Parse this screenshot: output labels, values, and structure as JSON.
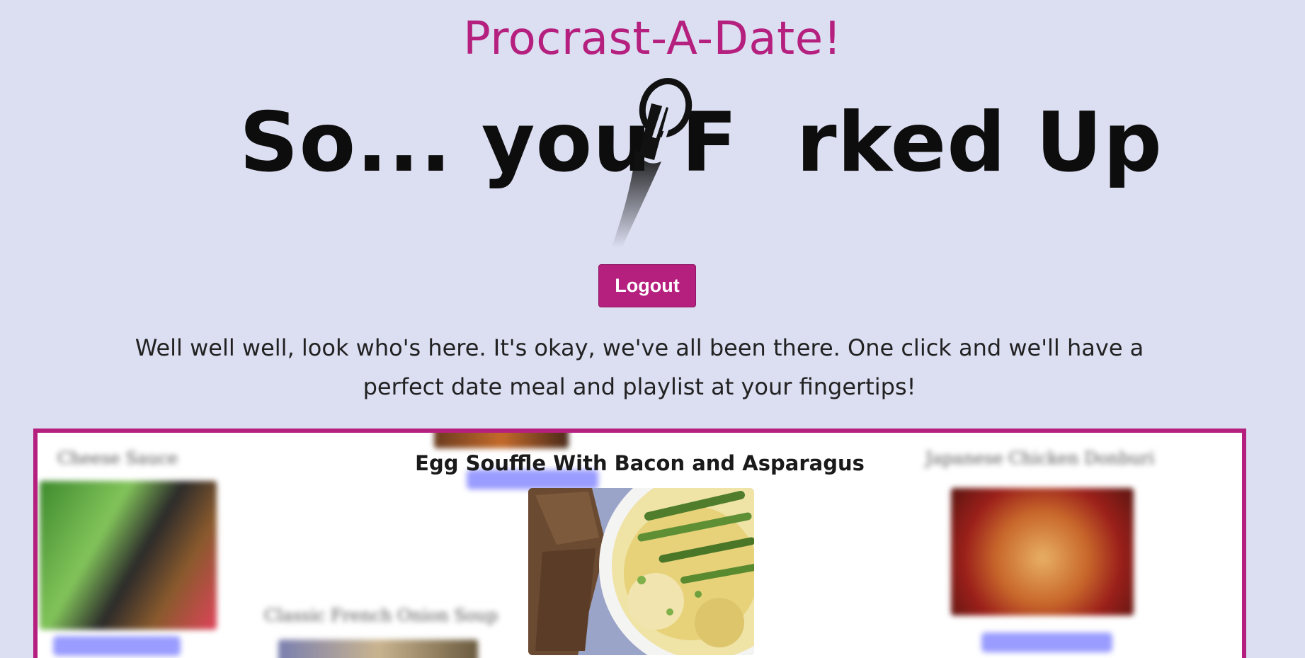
{
  "header": {
    "app_title": "Procrast-A-Date!",
    "logo_text_left": "So... you F",
    "logo_text_right": "rked Up"
  },
  "auth": {
    "logout_label": "Logout"
  },
  "intro": {
    "text": "Well well well, look who's here. It's okay, we've all been there. One click and we'll have a perfect date meal and playlist at your fingertips!"
  },
  "carousel": {
    "active": {
      "title": "Egg Souffle With Bacon and Asparagus",
      "image": "egg-souffle-photo"
    },
    "background_items": [
      {
        "title": "Cheese Sauce"
      },
      {
        "title": "Japanese Chicken Donburi"
      },
      {
        "title": "Classic French Onion Soup"
      }
    ]
  },
  "colors": {
    "accent": "#b5207f",
    "page_bg": "#dcdff2",
    "card_bg": "#ffffff",
    "blurred_button": "#9a9cff"
  },
  "icons": {
    "logo_fork": "fork-icon"
  }
}
